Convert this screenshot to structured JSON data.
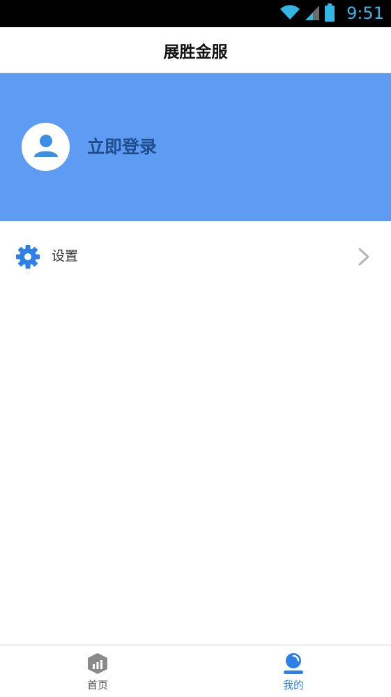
{
  "status_bar": {
    "time": "9:51",
    "icons": [
      "wifi-icon",
      "signal-icon",
      "battery-icon"
    ]
  },
  "header": {
    "title": "展胜金服"
  },
  "login": {
    "label": "立即登录",
    "avatar_icon": "user-avatar-icon"
  },
  "menu": {
    "items": [
      {
        "label": "设置",
        "icon": "gear-icon",
        "trailing_icon": "chevron-right-icon"
      }
    ]
  },
  "bottom_nav": {
    "items": [
      {
        "label": "首页",
        "icon": "home-chart-icon",
        "active": false
      },
      {
        "label": "我的",
        "icon": "profile-icon",
        "active": true
      }
    ]
  },
  "colors": {
    "header_bg": "#5e9cf3",
    "login_text": "#1f4c8a",
    "accent": "#2f7fe8",
    "status_time": "#33b5e5"
  }
}
